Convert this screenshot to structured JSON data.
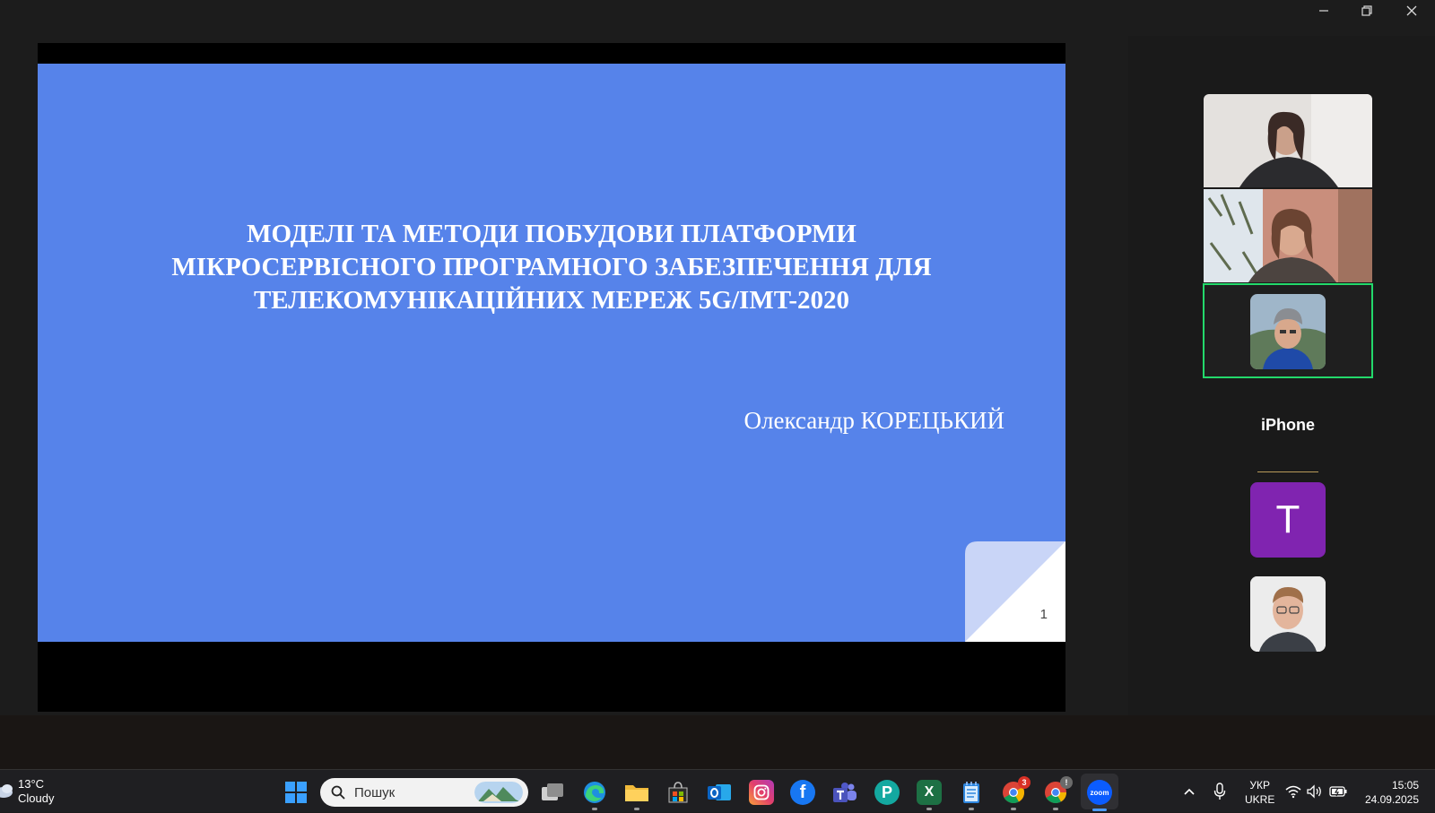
{
  "window": {
    "controls": {
      "minimize": "minimize",
      "restore": "restore",
      "close": "close"
    }
  },
  "slide": {
    "title_lines": [
      "МОДЕЛІ ТА МЕТОДИ ПОБУДОВИ ПЛАТФОРМИ",
      "МІКРОСЕРВІСНОГО ПРОГРАМНОГО ЗАБЕЗПЕЧЕННЯ ДЛЯ",
      "ТЕЛЕКОМУНІКАЦІЙНИХ МЕРЕЖ 5G/IMT-2020"
    ],
    "author": "Олександр КОРЕЦЬКИЙ",
    "page_number": "1",
    "background_color": "#5683ea"
  },
  "participants": {
    "name_tile_label": "iPhone",
    "letter_avatar": "T",
    "active_speaker_color": "#23d96b"
  },
  "taskbar": {
    "weather": {
      "temperature": "13°C",
      "condition": "Cloudy"
    },
    "search": {
      "placeholder": "Пошук"
    },
    "apps": [
      {
        "name": "task-view-icon"
      },
      {
        "name": "edge-icon"
      },
      {
        "name": "file-explorer-icon"
      },
      {
        "name": "store-icon"
      },
      {
        "name": "outlook-icon"
      },
      {
        "name": "instagram-icon"
      },
      {
        "name": "facebook-icon",
        "glyph": "f"
      },
      {
        "name": "teams-icon"
      },
      {
        "name": "pinterest-icon",
        "glyph": "P"
      },
      {
        "name": "excel-icon",
        "glyph": "X"
      },
      {
        "name": "notepad-icon"
      },
      {
        "name": "chrome-icon",
        "badge": "3"
      },
      {
        "name": "chrome-profile-icon",
        "badge": "!"
      },
      {
        "name": "zoom-icon",
        "glyph": "zoom"
      }
    ],
    "language": {
      "line1": "УКР",
      "line2": "UKRE"
    },
    "clock": {
      "time": "15:05",
      "date": "24.09.2025"
    }
  }
}
